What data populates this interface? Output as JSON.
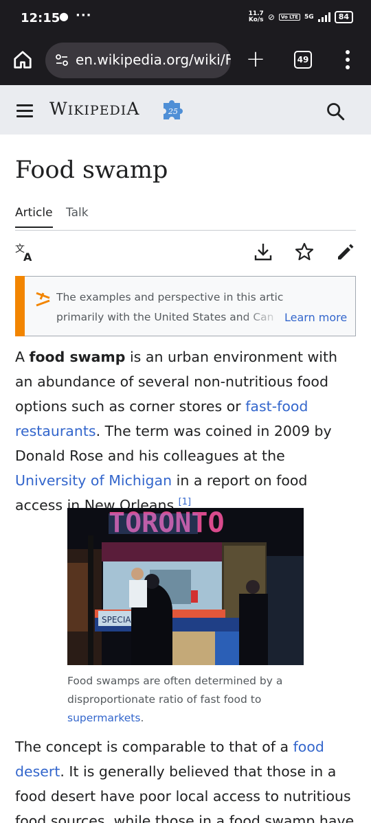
{
  "status_bar": {
    "time": "12:15",
    "net_speed_value": "11.7",
    "net_speed_unit": "Ko/s",
    "volte_label": "Vo LTE",
    "network": "5G",
    "battery": "84"
  },
  "browser": {
    "url": "en.wikipedia.org/wiki/F",
    "new_tab_symbol": "+",
    "tab_count": "49"
  },
  "wiki": {
    "logo_parts": [
      "W",
      "IKIPEDI",
      "A"
    ],
    "anniversary_badge": "25"
  },
  "article": {
    "title": "Food swamp",
    "tabs": [
      {
        "label": "Article",
        "selected": true
      },
      {
        "label": "Talk",
        "selected": false
      }
    ],
    "notice": {
      "line1": "The examples and perspective in this article deal",
      "line2": "primarily with the United States and Can",
      "learn_more": "Learn more"
    },
    "lead": {
      "t1": "A ",
      "bold": "food swamp",
      "t2": " is an urban environment with an abundance of several non-nutritious food options such as corner stores or ",
      "link1": "fast-food restaurants",
      "t3": ". The term was coined in 2009 by Donald Rose and his colleagues at the ",
      "link2": "University of Michigan",
      "t4": " in a report on food access in New Orleans.",
      "ref": "[1]"
    },
    "figure": {
      "sign_text": "TORONTO",
      "special_text": "SPECIAL",
      "caption_text": "Food swamps are often determined by a disproportionate ratio of fast food to ",
      "caption_link": "supermarkets",
      "caption_end": "."
    },
    "para2": {
      "t1": "The concept is comparable to that of a ",
      "link": "food desert",
      "t2": ". It is generally believed that those in a food desert have poor local access to nutritious food sources, while those in a food swamp have few grocery"
    }
  },
  "colors": {
    "link": "#3366cc",
    "notice_accent": "#f28500",
    "header_bg": "#eaecf0",
    "browser_bg": "#1c1b1f"
  }
}
